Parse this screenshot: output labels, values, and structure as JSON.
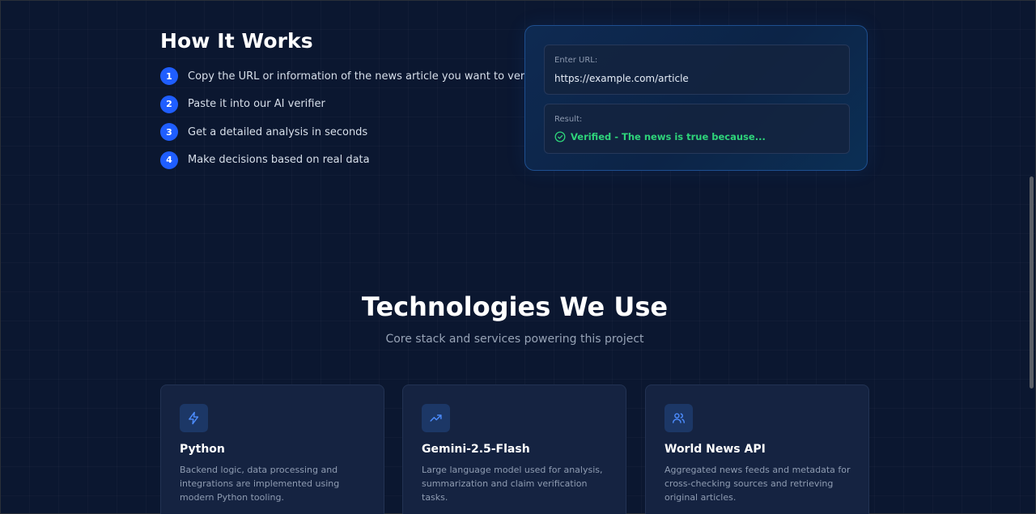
{
  "how_it_works": {
    "title": "How It Works",
    "steps": [
      {
        "number": "1",
        "text": "Copy the URL or information of the news article you want to verify."
      },
      {
        "number": "2",
        "text": "Paste it into our AI verifier"
      },
      {
        "number": "3",
        "text": "Get a detailed analysis in seconds"
      },
      {
        "number": "4",
        "text": "Make decisions based on real data"
      }
    ]
  },
  "demo": {
    "url_label": "Enter URL:",
    "url_value": "https://example.com/article",
    "result_label": "Result:",
    "result_text": "Verified - The news is true because...",
    "result_icon": "check-circle-icon",
    "result_color": "#2ed47a"
  },
  "technologies": {
    "title": "Technologies We Use",
    "subtitle": "Core stack and services powering this project",
    "cards": [
      {
        "icon": "lightning-icon",
        "name": "Python",
        "description": "Backend logic, data processing and integrations are implemented using modern Python tooling."
      },
      {
        "icon": "trending-up-icon",
        "name": "Gemini-2.5-Flash",
        "description": "Large language model used for analysis, summarization and claim verification tasks."
      },
      {
        "icon": "users-icon",
        "name": "World News API",
        "description": "Aggregated news feeds and metadata for cross-checking sources and retrieving original articles."
      }
    ]
  },
  "colors": {
    "background": "#0b1730",
    "accent": "#1f5eff",
    "success": "#2ed47a",
    "icon_blue": "#4d8dff"
  }
}
